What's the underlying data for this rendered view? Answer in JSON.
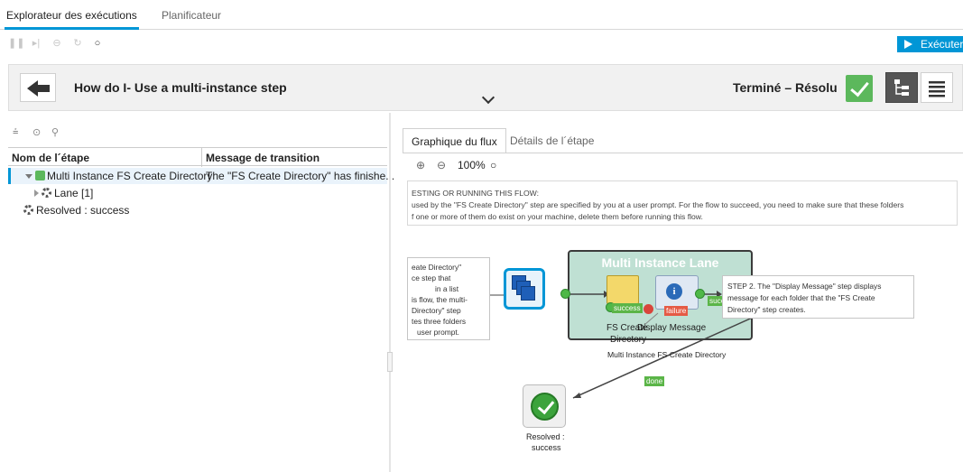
{
  "top_tabs": {
    "explorer": "Explorateur des exécutions",
    "scheduler": "Planificateur"
  },
  "toolbar": {
    "icons": [
      "pause-icon",
      "step-forward-icon",
      "minus-circle-icon",
      "resume-icon",
      "refresh-icon"
    ],
    "execute_label": "Exécuter"
  },
  "header": {
    "title": "How do I- Use a multi-instance step",
    "status": "Terminé – Résolu"
  },
  "tree": {
    "col_step": "Nom de l´étape",
    "col_transition": "Message de transition",
    "rows": [
      {
        "name": "Multi Instance FS Create Directory",
        "message": "The \"FS Create Directory\" has finishe..."
      },
      {
        "name": "Lane [1]",
        "message": ""
      },
      {
        "name": "Resolved : success",
        "message": ""
      }
    ]
  },
  "panel_tabs": {
    "graph": "Graphique du flux",
    "details": "Détails de l´étape"
  },
  "zoom": {
    "level": "100%"
  },
  "description": {
    "line1": "ESTING OR RUNNING THIS FLOW:",
    "line2": "used by the \"FS Create Directory\" step are specified by you at a user prompt. For the flow to succeed, you need to make sure that these folders",
    "line3": "f one or more of them do exist on your machine, delete them before running this flow."
  },
  "diagram": {
    "lane_title": "Multi Instance Lane",
    "note_left": [
      "eate Directory\"",
      "ce step that",
      "in a list",
      "is flow, the multi-",
      "Directory\" step",
      "tes three folders",
      "user prompt."
    ],
    "note_right": [
      "STEP 2. The \"Display Message\" step displays",
      "message for each folder that the \"FS Create",
      "Directory\" step creates."
    ],
    "fs_label_1": "FS Create",
    "fs_label_2": "Directory",
    "display_label": "Display Message",
    "mi_caption": "Multi Instance FS Create Directory",
    "success_1": "success",
    "success_2": "success",
    "failure": "failure",
    "done": "done",
    "resolved_1": "Resolved :",
    "resolved_2": "success",
    "info_glyph": "i"
  },
  "colors": {
    "accent": "#0096d6",
    "success": "#5cb85c",
    "lane_fill": "#bfe0d3",
    "failure": "#e55a45"
  }
}
